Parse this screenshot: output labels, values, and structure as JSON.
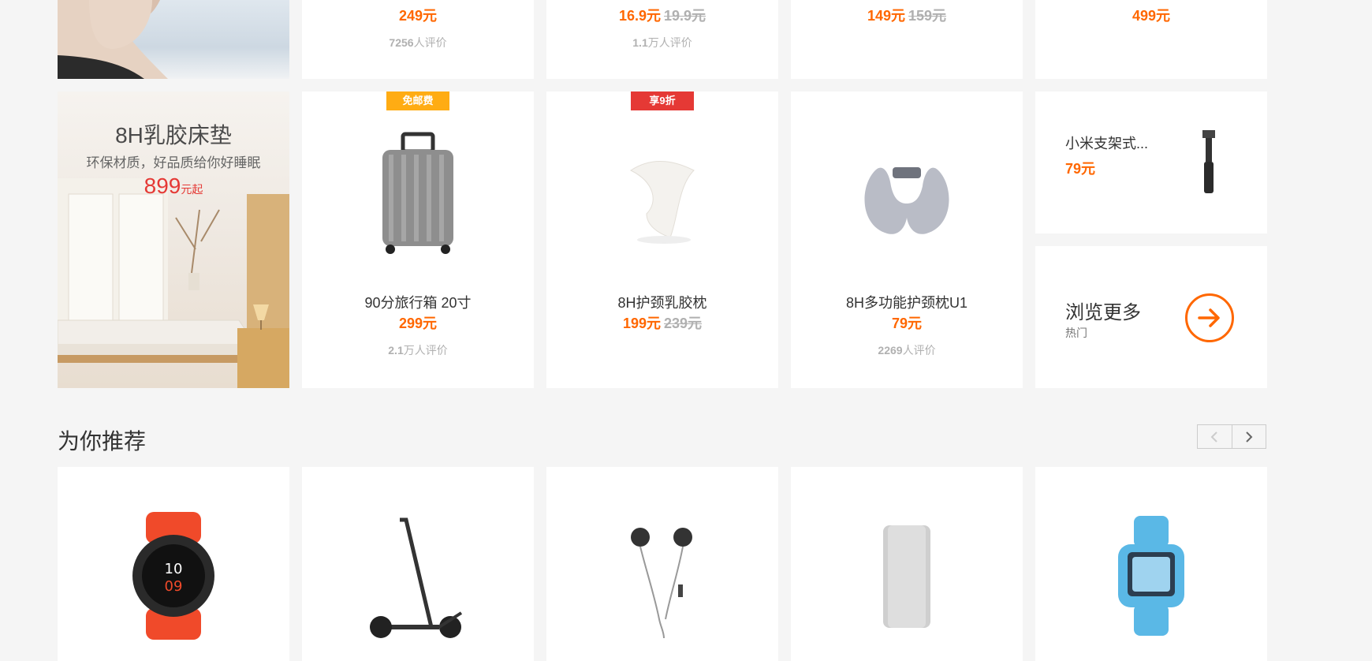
{
  "top_row": [
    {
      "price": "249元",
      "reviews_num": "7256",
      "reviews_text": "人评价"
    },
    {
      "price": "16.9元",
      "old_price": "19.9元",
      "reviews_num": "1.1",
      "reviews_text": "万人评价"
    },
    {
      "price": "149元",
      "old_price": "159元"
    },
    {
      "price": "499元"
    }
  ],
  "promo": {
    "title": "8H乳胶床垫",
    "subtitle": "环保材质，好品质给你好睡眠",
    "price": "899",
    "price_unit": "元起"
  },
  "products": [
    {
      "name": "90分旅行箱 20寸",
      "price": "299元",
      "reviews_num": "2.1",
      "reviews_text": "万人评价",
      "badge": "免邮费",
      "badge_color": "#ffac13",
      "icon": "suitcase-icon"
    },
    {
      "name": "8H护颈乳胶枕",
      "price": "199元",
      "old_price": "239元",
      "badge": "享9折",
      "badge_color": "#e53935",
      "icon": "pillow-icon"
    },
    {
      "name": "8H多功能护颈枕U1",
      "price": "79元",
      "reviews_num": "2269",
      "reviews_text": "人评价",
      "icon": "neck-pillow-icon"
    }
  ],
  "small_card": {
    "name": "小米支架式...",
    "price": "79元",
    "icon": "selfie-stick-icon"
  },
  "more_card": {
    "title": "浏览更多",
    "subtitle": "热门",
    "icon": "arrow-right-circle-icon"
  },
  "section": {
    "title": "为你推荐"
  },
  "recommend": [
    {
      "icon": "smartwatch-icon"
    },
    {
      "icon": "scooter-icon"
    },
    {
      "icon": "earphones-icon"
    },
    {
      "icon": "power-bank-icon"
    },
    {
      "icon": "kids-watch-icon"
    }
  ],
  "colors": {
    "accent": "#ff6700",
    "background": "#f5f5f5"
  }
}
